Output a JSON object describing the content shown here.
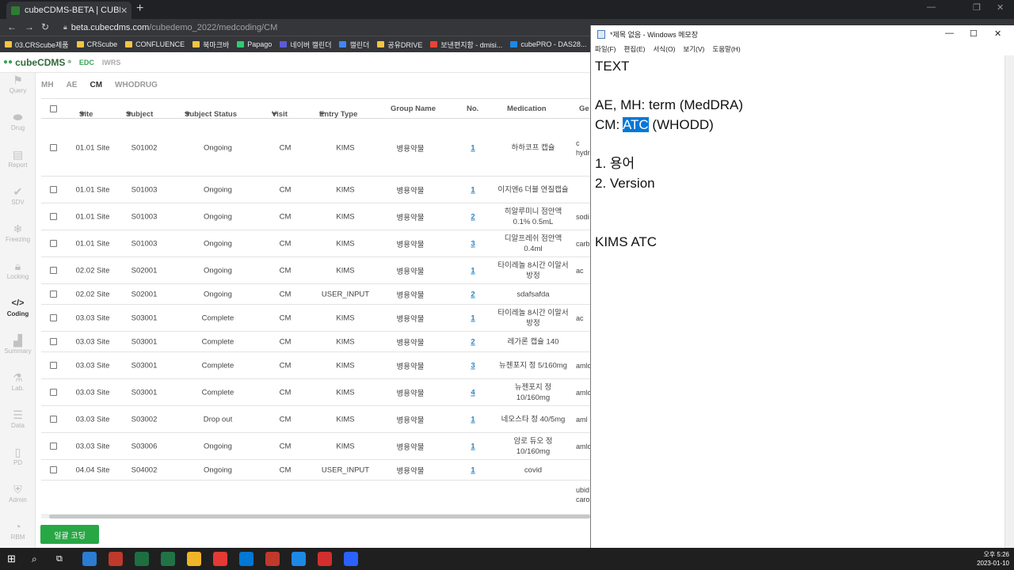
{
  "browser": {
    "tab_title": "cubeCDMS-BETA | CUBEDEMO_",
    "url_host": "beta.cubecdms.com",
    "url_path": "/cubedemo_2022/medcoding/CM",
    "bookmarks": [
      "03.CRScube제품",
      "CRScube",
      "CONFLUENCE",
      "북마크바",
      "Papago",
      "네이버 캘린더",
      "캘린더",
      "공유DRIVE",
      "보낸편지함 - dmisi...",
      "cubePRO - DAS28..."
    ]
  },
  "app": {
    "logo": "cubeCDMS",
    "top_nav": [
      "EDC",
      "IWRS"
    ],
    "left_nav": [
      {
        "label": "Query",
        "icon": "flag-icon"
      },
      {
        "label": "Drug",
        "icon": "pill-icon"
      },
      {
        "label": "Report",
        "icon": "document-icon"
      },
      {
        "label": "SDV",
        "icon": "check-icon"
      },
      {
        "label": "Freezing",
        "icon": "snowflake-icon"
      },
      {
        "label": "Locking",
        "icon": "lock-icon"
      },
      {
        "label": "Coding",
        "icon": "code-icon"
      },
      {
        "label": "Summary",
        "icon": "bar-chart-icon"
      },
      {
        "label": "Lab.",
        "icon": "flask-icon"
      },
      {
        "label": "Data",
        "icon": "database-icon"
      },
      {
        "label": "PD",
        "icon": "pdf-icon"
      },
      {
        "label": "Admin",
        "icon": "shield-icon"
      },
      {
        "label": "RBM",
        "icon": "gauge-icon"
      }
    ],
    "active_nav": "Coding",
    "sub_tabs": [
      "MH",
      "AE",
      "CM",
      "WHODRUG"
    ],
    "active_sub_tab": "CM",
    "columns": [
      "Site",
      "Subject",
      "Subject Status",
      "Visit",
      "Entry Type",
      "Group Name",
      "No.",
      "Medication",
      "Ge"
    ],
    "rows": [
      {
        "site": "01.01 Site",
        "subject": "S01002",
        "status": "Ongoing",
        "visit": "CM",
        "entry": "KIMS",
        "group": "병용약물",
        "no": "1",
        "med": "하하코프 캡슐",
        "gen": "c\nhydr"
      },
      {
        "site": "01.01 Site",
        "subject": "S01003",
        "status": "Ongoing",
        "visit": "CM",
        "entry": "KIMS",
        "group": "병용약물",
        "no": "1",
        "med": "이지엔6 더블 연질캡슐",
        "gen": ""
      },
      {
        "site": "01.01 Site",
        "subject": "S01003",
        "status": "Ongoing",
        "visit": "CM",
        "entry": "KIMS",
        "group": "병용약물",
        "no": "2",
        "med": "히알루미니 점안액 0.1% 0.5mL",
        "gen": "sodi"
      },
      {
        "site": "01.01 Site",
        "subject": "S01003",
        "status": "Ongoing",
        "visit": "CM",
        "entry": "KIMS",
        "group": "병용약물",
        "no": "3",
        "med": "디알프레쉬 점안액 0.4ml",
        "gen": "carb"
      },
      {
        "site": "02.02 Site",
        "subject": "S02001",
        "status": "Ongoing",
        "visit": "CM",
        "entry": "KIMS",
        "group": "병용약물",
        "no": "1",
        "med": "타이레놀 8시간 이알서방정",
        "gen": "ac"
      },
      {
        "site": "02.02 Site",
        "subject": "S02001",
        "status": "Ongoing",
        "visit": "CM",
        "entry": "USER_INPUT",
        "group": "병용약물",
        "no": "2",
        "med": "sdafsafda",
        "gen": ""
      },
      {
        "site": "03.03 Site",
        "subject": "S03001",
        "status": "Complete",
        "visit": "CM",
        "entry": "KIMS",
        "group": "병용약물",
        "no": "1",
        "med": "타이레놀 8시간 이알서방정",
        "gen": "ac"
      },
      {
        "site": "03.03 Site",
        "subject": "S03001",
        "status": "Complete",
        "visit": "CM",
        "entry": "KIMS",
        "group": "병용약물",
        "no": "2",
        "med": "레가론 캡슐 140",
        "gen": ""
      },
      {
        "site": "03.03 Site",
        "subject": "S03001",
        "status": "Complete",
        "visit": "CM",
        "entry": "KIMS",
        "group": "병용약물",
        "no": "3",
        "med": "뉴젠포지 정 5/160mg",
        "gen": "amlo"
      },
      {
        "site": "03.03 Site",
        "subject": "S03001",
        "status": "Complete",
        "visit": "CM",
        "entry": "KIMS",
        "group": "병용약물",
        "no": "4",
        "med": "뉴젠포지 정 10/160mg",
        "gen": "amlo"
      },
      {
        "site": "03.03 Site",
        "subject": "S03002",
        "status": "Drop out",
        "visit": "CM",
        "entry": "KIMS",
        "group": "병용약물",
        "no": "1",
        "med": "네오스타 정 40/5mg",
        "gen": "aml"
      },
      {
        "site": "03.03 Site",
        "subject": "S03006",
        "status": "Ongoing",
        "visit": "CM",
        "entry": "KIMS",
        "group": "병용약물",
        "no": "1",
        "med": "암로 듀오 정 10/160mg",
        "gen": "amlo"
      },
      {
        "site": "04.04 Site",
        "subject": "S04002",
        "status": "Ongoing",
        "visit": "CM",
        "entry": "USER_INPUT",
        "group": "병용약물",
        "no": "1",
        "med": "covid",
        "gen": ""
      }
    ],
    "top_partial_gen": "ac",
    "bottom_partial_gen": "ubid\ncaro",
    "bulk_button": "일괄 코딩"
  },
  "notepad": {
    "title": "*제목 없음 - Windows 메모장",
    "menu": [
      "파일(F)",
      "편집(E)",
      "서식(O)",
      "보기(V)",
      "도움말(H)"
    ],
    "line1": "TEXT",
    "line2": "",
    "line3": "AE, MH: term (MedDRA)",
    "line4_pre": "CM: ",
    "line4_sel": "ATC",
    "line4_post": " (WHODD)",
    "line5": "",
    "line6": "1. 용어",
    "line7": "2. Version",
    "line8": "",
    "line9": "",
    "line10": "KIMS ATC"
  },
  "taskbar": {
    "time": "오후 5:26",
    "date": "2023-01-10",
    "app_colors": [
      "#2b7cd3",
      "#c0392b",
      "#1d6f42",
      "#217346",
      "#f0b429",
      "#e53935",
      "#0078d4",
      "#c0392b",
      "#1e88e5",
      "#d32f2f",
      "#2962ff"
    ]
  }
}
